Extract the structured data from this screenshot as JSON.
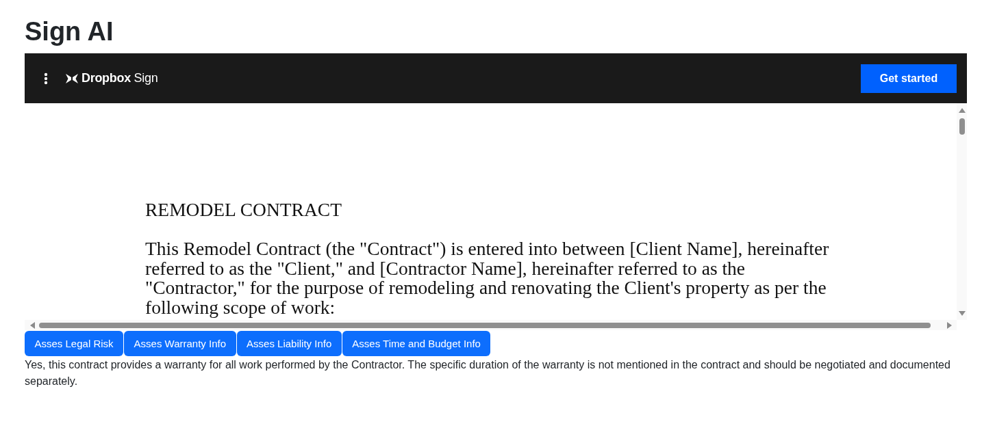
{
  "page": {
    "title": "Sign AI"
  },
  "header": {
    "logo": "**Dropbox** Sign",
    "button": "Get started"
  },
  "document": {
    "heading": "REMODEL CONTRACT",
    "paragraph": "This Remodel Contract (the \"Contract\") is entered into between [Client Name], hereinafter referred to as the \"Client,\" and [Contractor Name], hereinafter referred to as the \"Contractor,\" for the purpose of remodeling and renovating the Client's property as per the following scope of work:"
  },
  "actions": [
    "Asses Legal Risk",
    "Asses Warranty Info",
    "Asses Liability Info",
    "Asses Time and Budget Info"
  ],
  "answer": "Yes, this contract provides a warranty for all work performed by the Contractor. The specific duration of the warranty is not mentioned in the contract and should be negotiated and documented separately."
}
